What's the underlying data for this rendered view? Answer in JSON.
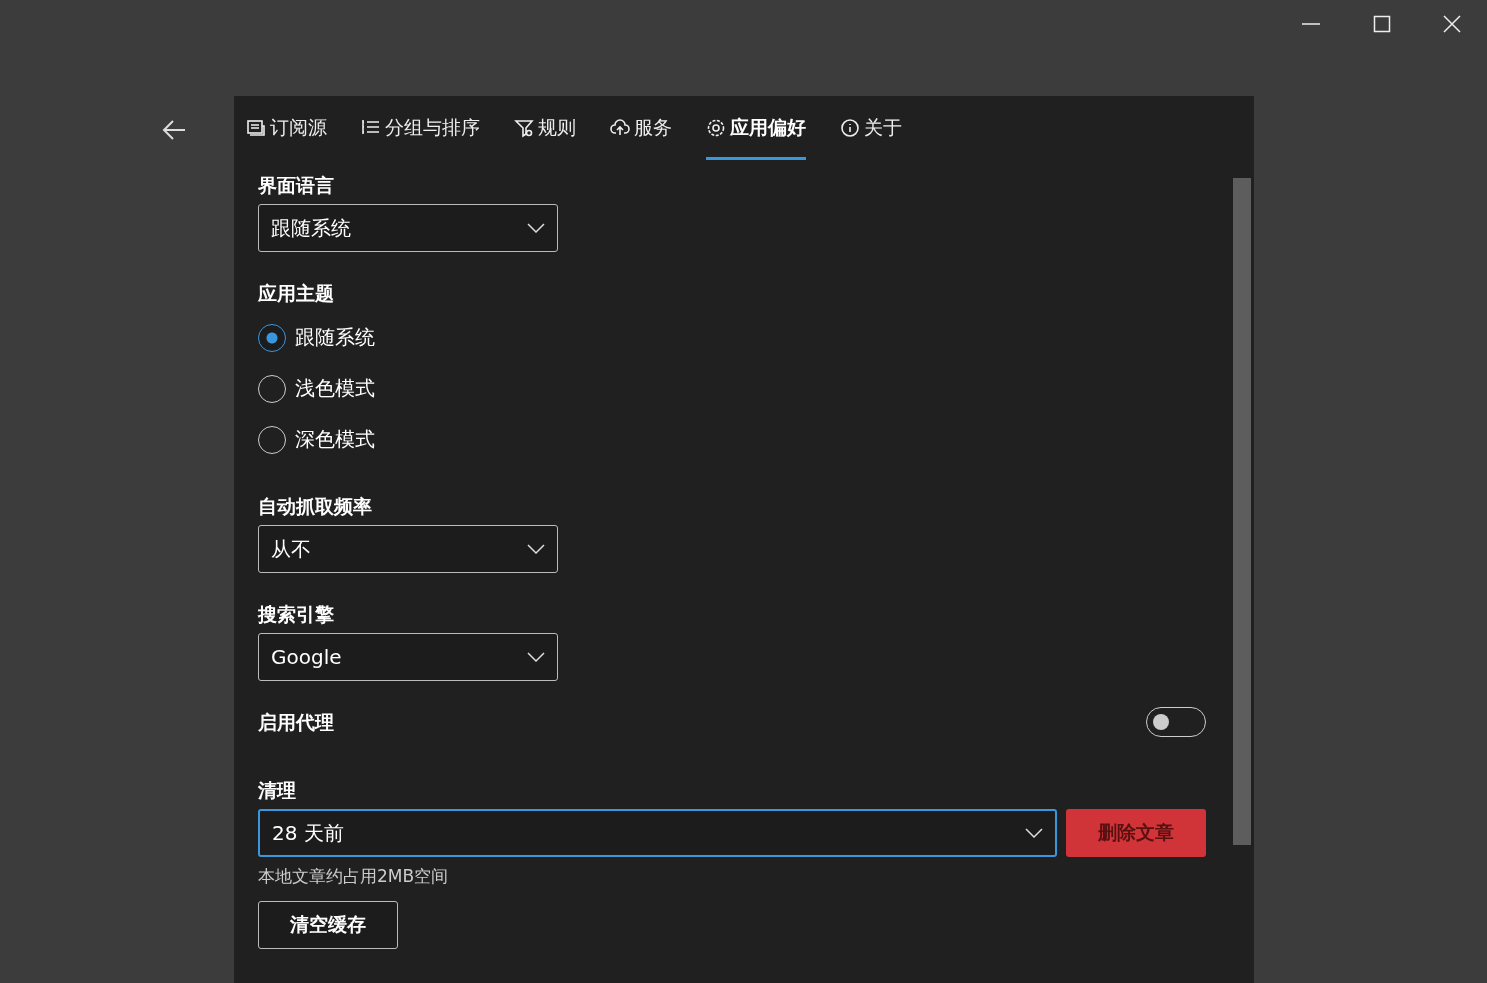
{
  "tabs": [
    {
      "kind": "feeds",
      "label": "订阅源",
      "selected": false
    },
    {
      "kind": "groups",
      "label": "分组与排序",
      "selected": false
    },
    {
      "kind": "rules",
      "label": "规则",
      "selected": false
    },
    {
      "kind": "services",
      "label": "服务",
      "selected": false
    },
    {
      "kind": "preferences",
      "label": "应用偏好",
      "selected": true
    },
    {
      "kind": "about",
      "label": "关于",
      "selected": false
    }
  ],
  "sections": [
    {
      "kind": "dropdown",
      "label": "界面语言",
      "value": "跟随系统"
    },
    {
      "kind": "radios",
      "label": "应用主题",
      "options": [
        {
          "label": "跟随系统",
          "selected": true
        },
        {
          "label": "浅色模式",
          "selected": false
        },
        {
          "label": "深色模式",
          "selected": false
        }
      ]
    },
    {
      "kind": "dropdown",
      "label": "自动抓取频率",
      "value": "从不"
    },
    {
      "kind": "dropdown",
      "label": "搜索引擎",
      "value": "Google"
    },
    {
      "kind": "toggle",
      "label": "启用代理",
      "on": false
    },
    {
      "kind": "cleanup",
      "label": "清理",
      "value": "28 天前",
      "button": "删除文章",
      "note": "本地文章约占用2MB空间",
      "secondary_button": "清空缓存"
    }
  ]
}
